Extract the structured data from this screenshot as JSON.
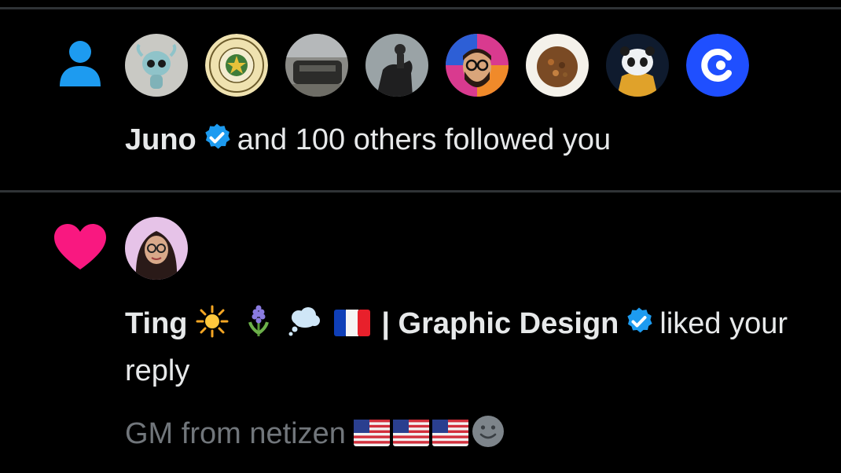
{
  "colors": {
    "background": "#000000",
    "divider": "#2f3336",
    "text": "#e7e9ea",
    "muted": "#71767b",
    "follow_icon": "#1d9bf0",
    "like_icon": "#f91880",
    "verified_badge": "#1d9bf0"
  },
  "notifications": [
    {
      "type": "follow",
      "icon": "person-icon",
      "avatars": [
        "alien-creature-avatar",
        "cherokee-nation-seal-avatar",
        "vehicle-photo-avatar",
        "horse-rider-avatar",
        "bearded-man-glasses-avatar",
        "food-bowl-avatar",
        "panda-hoodie-avatar",
        "blue-c-logo-avatar"
      ],
      "user_name": "Juno",
      "verified": true,
      "text": "and 100 others followed you"
    },
    {
      "type": "like",
      "icon": "heart-icon",
      "avatars": [
        "woman-glasses-avatar"
      ],
      "user_name": "Ting",
      "name_emojis": [
        "sun-emoji",
        "hyacinth-emoji",
        "thought-bubble-emoji",
        "france-flag-emoji"
      ],
      "user_suffix": "| Graphic Design",
      "verified": true,
      "text_line1": "liked your",
      "text_line2": "reply",
      "preview": "GM from netizen",
      "preview_emojis": [
        "us-flag-emoji",
        "us-flag-emoji",
        "us-flag-emoji",
        "slightly-smiling-face-emoji"
      ]
    }
  ]
}
